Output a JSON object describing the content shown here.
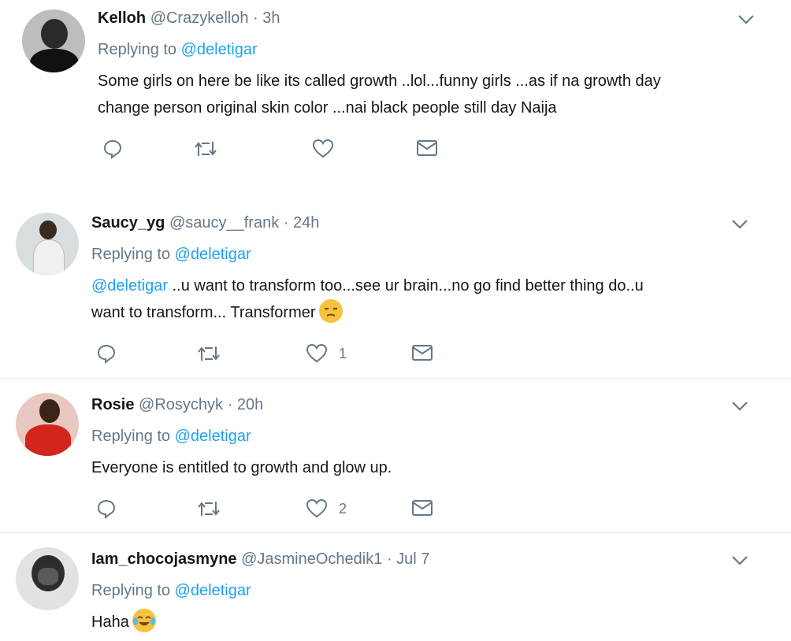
{
  "tweets": [
    {
      "name": "Kelloh",
      "handle": "@Crazykelloh",
      "dot": "·",
      "time": "3h",
      "replying_label": "Replying to",
      "replying_to": "@deletigar",
      "text_lines": [
        "Some girls on here be like its called growth ..lol...funny girls ...as if na growth day",
        "change person original skin color ...nai black people still day Naija"
      ],
      "like_count": ""
    },
    {
      "name": "Saucy_yg",
      "handle": "@saucy__frank",
      "dot": "·",
      "time": "24h",
      "replying_label": "Replying to",
      "replying_to": "@deletigar",
      "text_mention": "@deletigar",
      "text_line1_rest": " ..u want to transform too...see ur brain...no go find better thing do..u",
      "text_line2": "want to transform... Transformer",
      "like_count": "1"
    },
    {
      "name": "Rosie",
      "handle": "@Rosychyk",
      "dot": "·",
      "time": "20h",
      "replying_label": "Replying to",
      "replying_to": "@deletigar",
      "text": "Everyone is entitled to growth and glow up.",
      "like_count": "2"
    },
    {
      "name": "Iam_chocojasmyne",
      "handle": "@JasmineOchedik1",
      "dot": "·",
      "time": "Jul 7",
      "replying_label": "Replying to",
      "replying_to": "@deletigar",
      "text": "Haha",
      "like_count": ""
    }
  ],
  "icons": {
    "reply": "reply-icon",
    "retweet": "retweet-icon",
    "like": "heart-icon",
    "dm": "envelope-icon",
    "more": "chevron-down-icon"
  },
  "colors": {
    "link": "#1da1f2",
    "secondary": "#657786",
    "text": "#14171a",
    "divider": "#e6ecf0"
  }
}
